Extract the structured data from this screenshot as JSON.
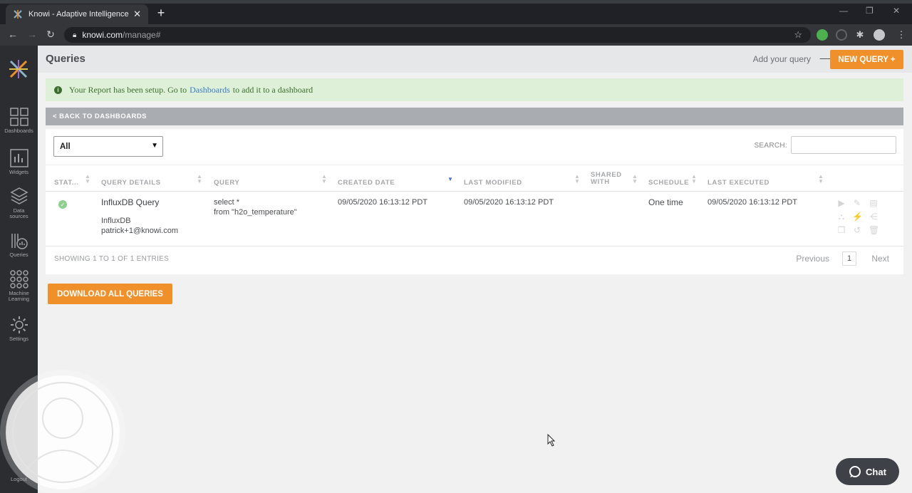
{
  "browser": {
    "tab_title": "Knowi - Adaptive Intelligence",
    "tab_close": "✕",
    "new_tab": "+",
    "url_host": "knowi.com",
    "url_path": "/manage#"
  },
  "sidebar": {
    "items": [
      {
        "label": "Dashboards"
      },
      {
        "label": "Widgets"
      },
      {
        "label": "Data sources"
      },
      {
        "label": "Queries"
      },
      {
        "label": "Machine Learning"
      },
      {
        "label": "Settings"
      }
    ],
    "logout": "Logout"
  },
  "header": {
    "title": "Queries",
    "add_hint": "Add your query",
    "arrow": "⟶",
    "new_query": "NEW QUERY +"
  },
  "alert": {
    "before": "Your Report has been setup. Go to",
    "link": "Dashboards",
    "after": "to add it to a dashboard"
  },
  "back_bar": "< BACK TO DASHBOARDS",
  "filter": {
    "value": "All"
  },
  "search": {
    "label": "SEARCH:"
  },
  "table": {
    "headers": [
      "STAT...",
      "QUERY DETAILS",
      "QUERY",
      "CREATED DATE",
      "LAST MODIFIED",
      "SHARED",
      "WITH",
      "SCHEDULE",
      "LAST EXECUTED"
    ],
    "row": {
      "name": "InfluxDB Query",
      "source": "InfluxDB",
      "owner": "patrick+1@knowi.com",
      "query_line1": "select *",
      "query_line2": "from \"h2o_temperature\"",
      "created": "09/05/2020 16:13:12 PDT",
      "modified": "09/05/2020 16:13:12 PDT",
      "schedule": "One time",
      "executed": "09/05/2020 16:13:12 PDT"
    }
  },
  "pagination": {
    "info": "SHOWING 1 TO 1 OF 1 ENTRIES",
    "previous": "Previous",
    "page": "1",
    "next": "Next"
  },
  "download_all": "DOWNLOAD ALL QUERIES",
  "chat": "Chat",
  "colors": {
    "accent": "#f0902b",
    "sidebar": "#2b2d31",
    "alert_bg": "#dff0d8",
    "link": "#3a7bc1"
  }
}
